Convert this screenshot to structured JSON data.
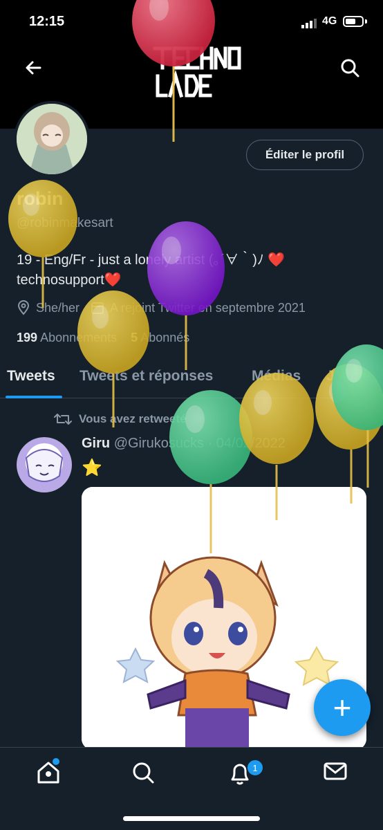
{
  "status_bar": {
    "time": "12:15",
    "network": "4G"
  },
  "banner": {
    "logo_text_top": "TECHNO",
    "logo_text_bottom": "BLADE"
  },
  "profile": {
    "edit_button": "Éditer le profil",
    "name": "robin",
    "handle": "@robinmakesart",
    "bio_line1": "19 - Eng/Fr - just a lonely artist (｡´∀｀)ﾉ ❤️",
    "bio_line2": "technosupport❤️",
    "pronouns": "She/her",
    "joined": "A rejoint Twitter en septembre 2021",
    "following_count": "199",
    "following_label": "Abonnements",
    "followers_count": "5",
    "followers_label": "Abonnés"
  },
  "tabs": [
    "Tweets",
    "Tweets et réponses",
    "Médias",
    "J'aime"
  ],
  "tweet": {
    "retweet_label": "Vous avez retweeté",
    "author_name": "Giru",
    "author_handle": "@Girukosucks",
    "date": "· 04/02/2022",
    "content": "⭐"
  },
  "fab": {
    "label": "+"
  },
  "bottom_nav": {
    "notification_count": "1"
  },
  "colors": {
    "accent": "#1d9bf0",
    "background": "#15202b"
  },
  "icons": [
    "back-arrow-icon",
    "search-icon",
    "location-icon",
    "calendar-icon",
    "retweet-icon",
    "home-icon",
    "notifications-icon",
    "messages-icon"
  ]
}
